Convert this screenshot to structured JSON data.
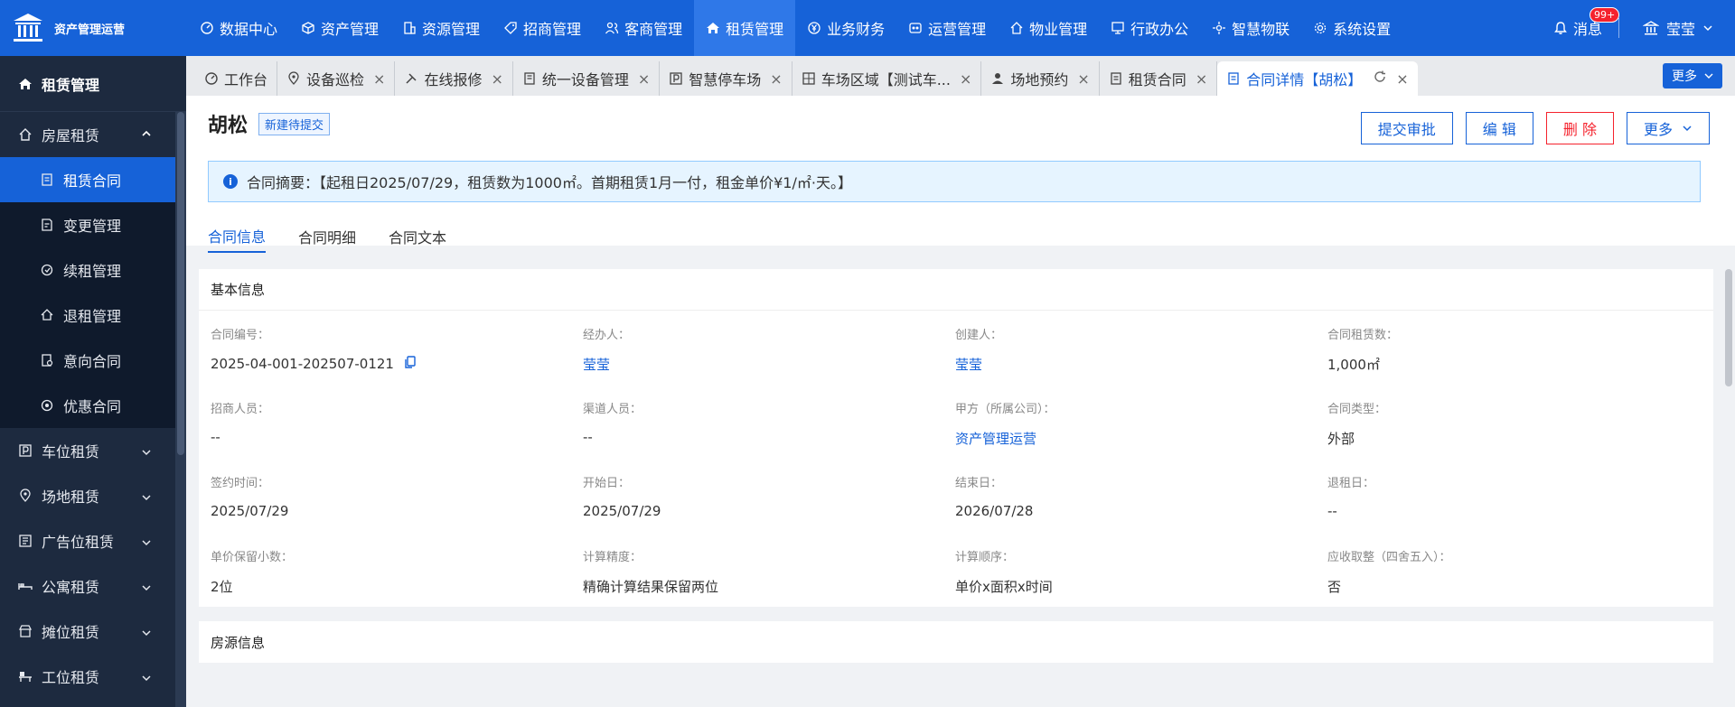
{
  "brand": {
    "name": "资产管理运营"
  },
  "nav": [
    {
      "label": "数据中心",
      "icon": "dashboard-icon"
    },
    {
      "label": "资产管理",
      "icon": "cube-icon"
    },
    {
      "label": "资源管理",
      "icon": "building-icon"
    },
    {
      "label": "招商管理",
      "icon": "tag-icon"
    },
    {
      "label": "客商管理",
      "icon": "users-icon"
    },
    {
      "label": "租赁管理",
      "icon": "home-icon",
      "active": true
    },
    {
      "label": "业务财务",
      "icon": "yen-icon"
    },
    {
      "label": "运营管理",
      "icon": "operations-icon"
    },
    {
      "label": "物业管理",
      "icon": "house-icon"
    },
    {
      "label": "行政办公",
      "icon": "monitor-icon"
    },
    {
      "label": "智慧物联",
      "icon": "iot-icon"
    },
    {
      "label": "系统设置",
      "icon": "gear-icon"
    }
  ],
  "topright": {
    "message_label": "消息",
    "badge": "99+",
    "user": "莹莹"
  },
  "sidebar": {
    "title": "租赁管理",
    "group_open": "房屋租赁",
    "subitems": [
      {
        "label": "租赁合同",
        "icon": "contract-icon",
        "active": true
      },
      {
        "label": "变更管理",
        "icon": "edit-doc-icon"
      },
      {
        "label": "续租管理",
        "icon": "renew-icon"
      },
      {
        "label": "退租管理",
        "icon": "return-icon"
      },
      {
        "label": "意向合同",
        "icon": "intent-icon"
      },
      {
        "label": "优惠合同",
        "icon": "discount-icon"
      }
    ],
    "groups": [
      {
        "label": "车位租赁",
        "icon": "parking-icon"
      },
      {
        "label": "场地租赁",
        "icon": "location-icon"
      },
      {
        "label": "广告位租赁",
        "icon": "ad-icon"
      },
      {
        "label": "公寓租赁",
        "icon": "bed-icon"
      },
      {
        "label": "摊位租赁",
        "icon": "stall-icon"
      },
      {
        "label": "工位租赁",
        "icon": "desk-icon"
      }
    ]
  },
  "tabs": [
    {
      "label": "工作台",
      "icon": "dashboard-icon",
      "closable": false
    },
    {
      "label": "设备巡检",
      "icon": "location-icon",
      "closable": true
    },
    {
      "label": "在线报修",
      "icon": "tools-icon",
      "closable": true
    },
    {
      "label": "统一设备管理",
      "icon": "device-icon",
      "closable": true
    },
    {
      "label": "智慧停车场",
      "icon": "parking-icon",
      "closable": true
    },
    {
      "label": "车场区域【测试车...",
      "icon": "area-icon",
      "closable": true
    },
    {
      "label": "场地预约",
      "icon": "user-icon",
      "closable": true
    },
    {
      "label": "租赁合同",
      "icon": "contract-icon",
      "closable": true
    },
    {
      "label": "合同详情【胡松】",
      "icon": "doc-icon",
      "closable": true,
      "active": true
    }
  ],
  "tab_more_label": "更多",
  "page": {
    "title": "胡松",
    "status": "新建待提交",
    "actions": {
      "submit": "提交审批",
      "edit": "编 辑",
      "delete": "删 除",
      "more": "更多"
    },
    "summary": "合同摘要：【起租日2025/07/29，租赁数为1000㎡。首期租赁1月一付，租金单价¥1/㎡·天。】",
    "subtabs": [
      "合同信息",
      "合同明细",
      "合同文本"
    ]
  },
  "basic_info": {
    "title": "基本信息",
    "fields": [
      {
        "label": "合同编号：",
        "value": "2025-04-001-202507-0121",
        "copy": true
      },
      {
        "label": "经办人：",
        "value": "莹莹",
        "link": true
      },
      {
        "label": "创建人：",
        "value": "莹莹",
        "link": true
      },
      {
        "label": "合同租赁数：",
        "value": "1,000㎡"
      },
      {
        "label": "招商人员：",
        "value": "--"
      },
      {
        "label": "渠道人员：",
        "value": "--"
      },
      {
        "label": "甲方（所属公司）：",
        "value": "资产管理运营",
        "link": true
      },
      {
        "label": "合同类型：",
        "value": "外部"
      },
      {
        "label": "签约时间：",
        "value": "2025/07/29"
      },
      {
        "label": "开始日：",
        "value": "2025/07/29"
      },
      {
        "label": "结束日：",
        "value": "2026/07/28"
      },
      {
        "label": "退租日：",
        "value": "--"
      },
      {
        "label": "单价保留小数：",
        "value": "2位"
      },
      {
        "label": "计算精度：",
        "value": "精确计算结果保留两位"
      },
      {
        "label": "计算顺序：",
        "value": "单价x面积x时间"
      },
      {
        "label": "应收取整（四舍五入）：",
        "value": "否"
      }
    ]
  },
  "house_info": {
    "title": "房源信息"
  }
}
